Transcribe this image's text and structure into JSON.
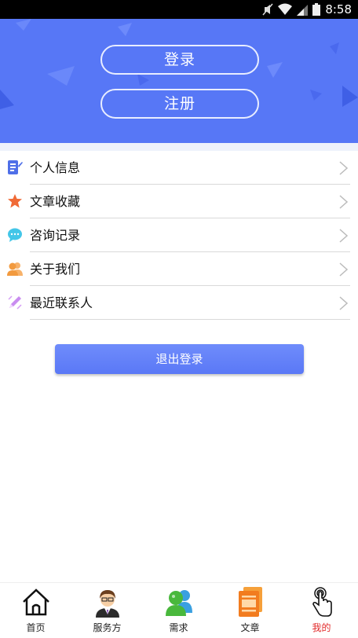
{
  "status_bar": {
    "time": "8:58"
  },
  "hero": {
    "login_label": "登录",
    "register_label": "注册"
  },
  "menu": {
    "items": [
      {
        "label": "个人信息",
        "icon": "document-icon"
      },
      {
        "label": "文章收藏",
        "icon": "star-icon"
      },
      {
        "label": "咨询记录",
        "icon": "chat-bubble-icon"
      },
      {
        "label": "关于我们",
        "icon": "people-icon"
      },
      {
        "label": "最近联系人",
        "icon": "pencil-icon"
      }
    ]
  },
  "logout_label": "退出登录",
  "tabbar": {
    "items": [
      {
        "label": "首页",
        "icon": "home-icon"
      },
      {
        "label": "服务方",
        "icon": "service-provider-icon"
      },
      {
        "label": "需求",
        "icon": "demand-icon"
      },
      {
        "label": "文章",
        "icon": "article-icon"
      },
      {
        "label": "我的",
        "icon": "touch-hand-icon",
        "active": true
      }
    ]
  },
  "colors": {
    "brand_blue": "#5777f6",
    "active_tab": "#e22a2a"
  }
}
